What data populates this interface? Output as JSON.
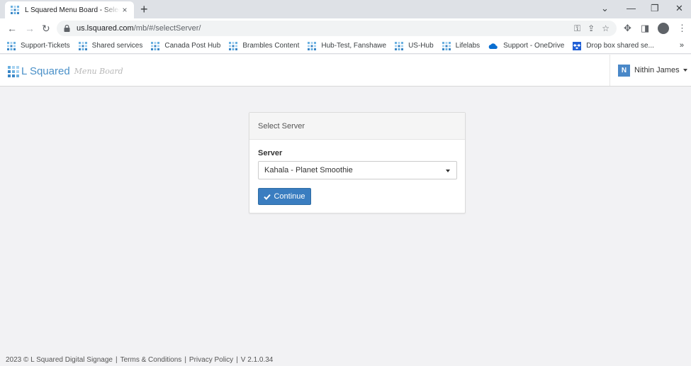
{
  "browser": {
    "tab_title": "L Squared Menu Board - Select S",
    "tab_close": "×",
    "new_tab": "+",
    "url_host": "us.lsquared.com",
    "url_path": "/mb/#/selectServer/",
    "bookmarks": [
      {
        "label": "Support-Tickets",
        "icon": "lsquared-icon"
      },
      {
        "label": "Shared services",
        "icon": "lsquared-icon"
      },
      {
        "label": "Canada Post Hub",
        "icon": "lsquared-icon"
      },
      {
        "label": "Brambles Content",
        "icon": "lsquared-icon"
      },
      {
        "label": "Hub-Test, Fanshawe",
        "icon": "lsquared-icon"
      },
      {
        "label": "US-Hub",
        "icon": "lsquared-icon"
      },
      {
        "label": "Lifelabs",
        "icon": "lsquared-icon"
      },
      {
        "label": "Support - OneDrive",
        "icon": "onedrive-icon"
      },
      {
        "label": "Drop box shared se...",
        "icon": "dropbox-icon"
      }
    ],
    "bookmarks_more": "»"
  },
  "app": {
    "brand_name": "L Squared",
    "brand_sub": "Menu Board",
    "user_initial": "N",
    "user_name": "Nithin James"
  },
  "panel": {
    "heading": "Select Server",
    "server_label": "Server",
    "server_selected": "Kahala - Planet Smoothie",
    "continue_label": "Continue"
  },
  "footer": {
    "copyright": "2023 © L Squared Digital Signage",
    "terms": "Terms & Conditions",
    "privacy": "Privacy Policy",
    "version": "V 2.1.0.34",
    "separator": "|"
  },
  "colors": {
    "brand_blue": "#4a90c8",
    "button_blue": "#3a7dc0",
    "page_bg": "#f2f2f4"
  }
}
